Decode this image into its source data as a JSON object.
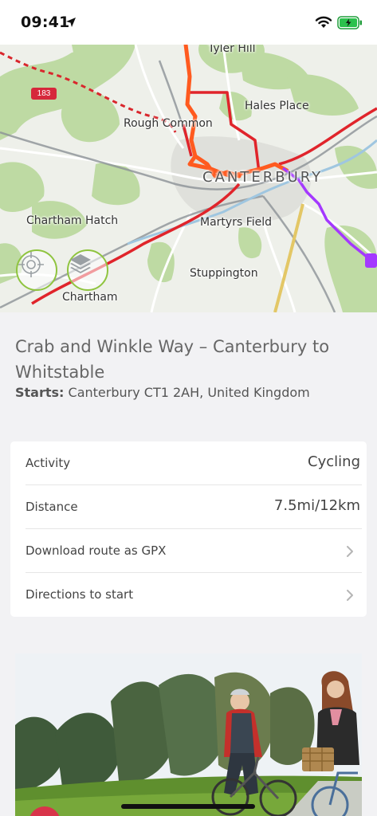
{
  "status_bar": {
    "time": "09:41"
  },
  "map": {
    "road_badge": "183",
    "labels": {
      "tyler_hill": "Tyler Hill",
      "hales_place": "Hales Place",
      "rough_common": "Rough Common",
      "canterbury": "CANTERBURY",
      "chartham_hatch": "Chartham Hatch",
      "martyrs_field": "Martyrs Field",
      "stuppington": "Stuppington",
      "chartham": "Chartham"
    },
    "controls": {
      "locate_icon": "crosshair-icon",
      "layers_icon": "layers-icon"
    },
    "colors": {
      "route_primary": "#ff5a1f",
      "route_red": "#e0242b",
      "route_purple": "#a438ff",
      "accent_green": "#8fc43f"
    }
  },
  "route": {
    "title": "Crab and Winkle Way – Canterbury to Whitstable",
    "starts_label": "Starts:",
    "starts_value": "Canterbury CT1 2AH, United Kingdom"
  },
  "info": {
    "activity_label": "Activity",
    "activity_value": "Cycling",
    "distance_label": "Distance",
    "distance_value": "7.5mi/12km",
    "download_label": "Download route as GPX",
    "directions_label": "Directions to start"
  }
}
